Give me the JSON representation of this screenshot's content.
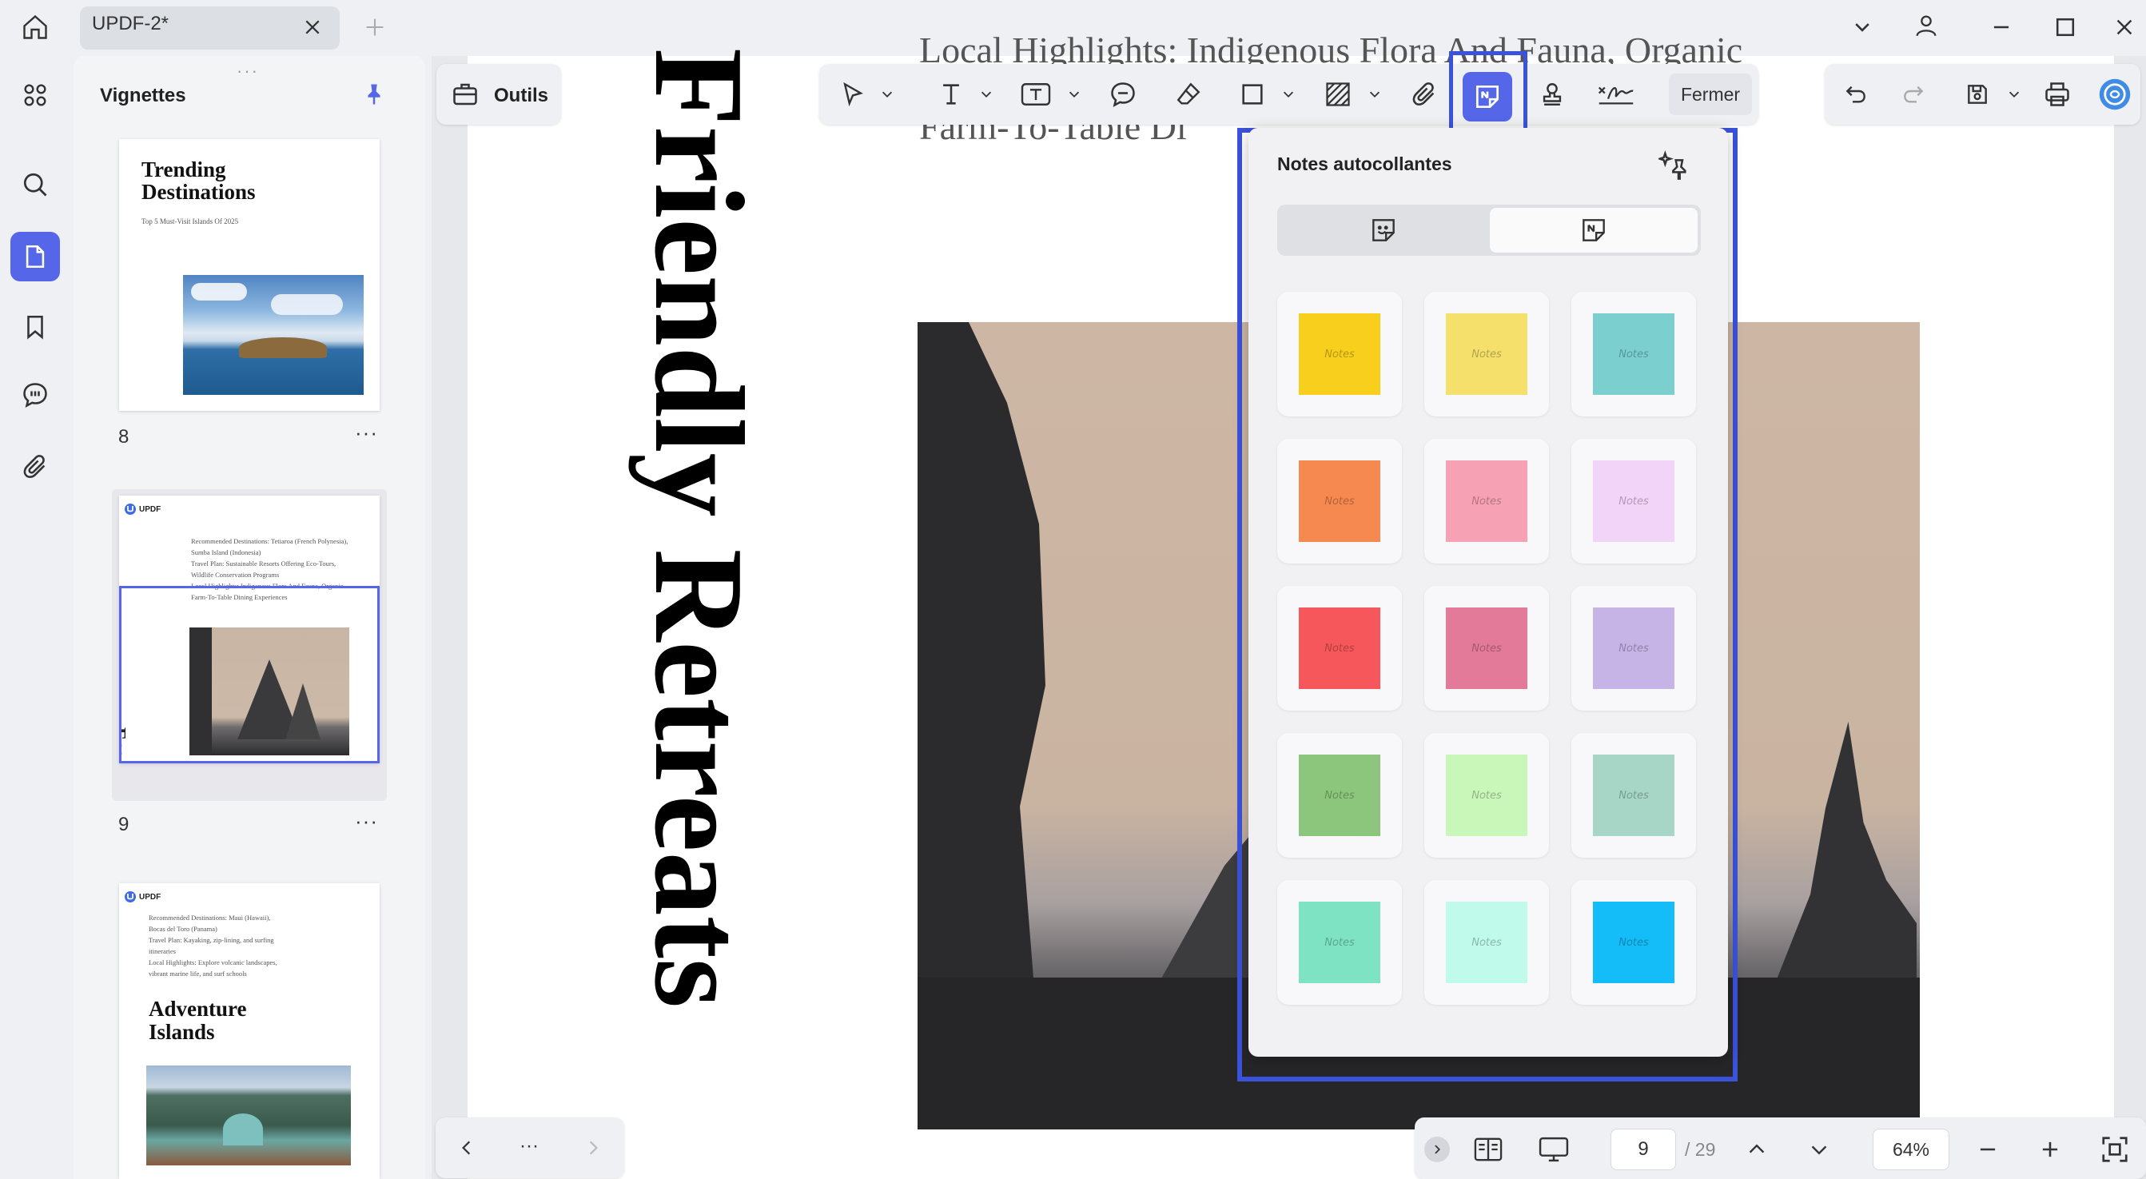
{
  "titlebar": {
    "tab_title": "UPDF-2*"
  },
  "toolbar": {
    "tools_label": "Outils",
    "close_label": "Fermer"
  },
  "thumbnails": {
    "title": "Vignettes",
    "pages": [
      {
        "number": "8",
        "title": "Trending\nDestinations",
        "subtitle": "Top 5 Must-Visit Islands Of 2025"
      },
      {
        "number": "9",
        "logo": "UPDF",
        "vertical_title": "Eco-Friendly Retreats",
        "lines": [
          "Recommended Destinations: Tetiaroa (French Polynesia),",
          "Sumba Island (Indonesia)",
          "Travel Plan: Sustainable Resorts Offering Eco-Tours,",
          "Wildlife Conservation Programs",
          "Local Highlights: Indigenous Flora And Fauna, Organic",
          "Farm-To-Table Dining Experiences"
        ]
      },
      {
        "number": "",
        "logo": "UPDF",
        "title": "Adventure\nIslands",
        "lines": [
          "Recommended Destinations: Maui (Hawaii),",
          "Bocas del Toro (Panama)",
          "Travel Plan: Kayaking, zip-lining, and surfing",
          "itineraries",
          "Local Highlights: Explore volcanic landscapes,",
          "vibrant marine life, and surf schools"
        ]
      }
    ]
  },
  "document": {
    "vertical_title": "Friendly Retreats",
    "top_line1": "Local Highlights: Indigenous Flora And Fauna, Organic",
    "top_line2": "Farm-To-Table Di"
  },
  "sticky_notes": {
    "title": "Notes autocollantes",
    "swatch_text": "Notes",
    "colors": [
      "#f8cf1d",
      "#f4e06a",
      "#7ccfcf",
      "#f6894f",
      "#f7a1b5",
      "#f1d4f7",
      "#f6575a",
      "#e47a9a",
      "#c7b4e6",
      "#8cc67c",
      "#c9f7ba",
      "#a7d6c7",
      "#7de3c3",
      "#bffaeb",
      "#14bcf8"
    ]
  },
  "navigation": {
    "current_page": "9",
    "total_pages": "/ 29",
    "zoom": "64%"
  },
  "colors": {
    "accent": "#5567e8",
    "highlight_border": "#3b52db"
  }
}
